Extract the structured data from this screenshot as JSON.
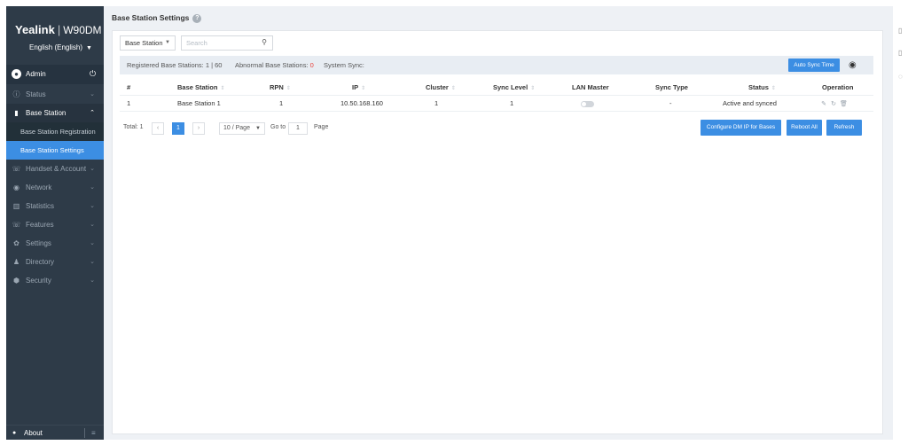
{
  "sidebar": {
    "brand": "Yealink",
    "model": "W90DM",
    "language": "English (English)",
    "user": "Admin",
    "nav": {
      "status": "Status",
      "base_station": "Base Station",
      "base_station_registration": "Base Station Registration",
      "base_station_settings": "Base Station Settings",
      "handset_account": "Handset & Account",
      "network": "Network",
      "statistics": "Statistics",
      "features": "Features",
      "settings": "Settings",
      "directory": "Directory",
      "security": "Security"
    },
    "about": "About"
  },
  "main": {
    "title": "Base Station Settings",
    "filter": {
      "selected": "Base Station",
      "search_placeholder": "Search"
    },
    "stats": {
      "registered_label": "Registered Base Stations:",
      "registered_value": "1 | 60",
      "abnormal_label": "Abnormal Base Stations:",
      "abnormal_value": "0",
      "system_sync_label": "System Sync:",
      "auto_sync_button": "Auto Sync Time"
    },
    "table": {
      "headers": {
        "index": "#",
        "base_station": "Base Station",
        "rpn": "RPN",
        "ip": "IP",
        "cluster": "Cluster",
        "sync_level": "Sync Level",
        "lan_master": "LAN Master",
        "sync_type": "Sync Type",
        "status": "Status",
        "operation": "Operation"
      },
      "rows": [
        {
          "index": "1",
          "base_station": "Base Station 1",
          "rpn": "1",
          "ip": "10.50.168.160",
          "cluster": "1",
          "sync_level": "1",
          "sync_type": "-",
          "status": "Active and synced"
        }
      ]
    },
    "pagination": {
      "total": "Total: 1",
      "current_page": "1",
      "per_page": "10 / Page",
      "goto_label": "Go to",
      "goto_value": "1",
      "page_label": "Page"
    },
    "actions": {
      "configure_dm_ip": "Configure DM IP for Bases",
      "reboot_all": "Reboot All",
      "refresh": "Refresh"
    }
  },
  "colors": {
    "accent": "#3c8ee3",
    "sidebar_bg": "#2e3b48",
    "alert": "#e8423c"
  }
}
